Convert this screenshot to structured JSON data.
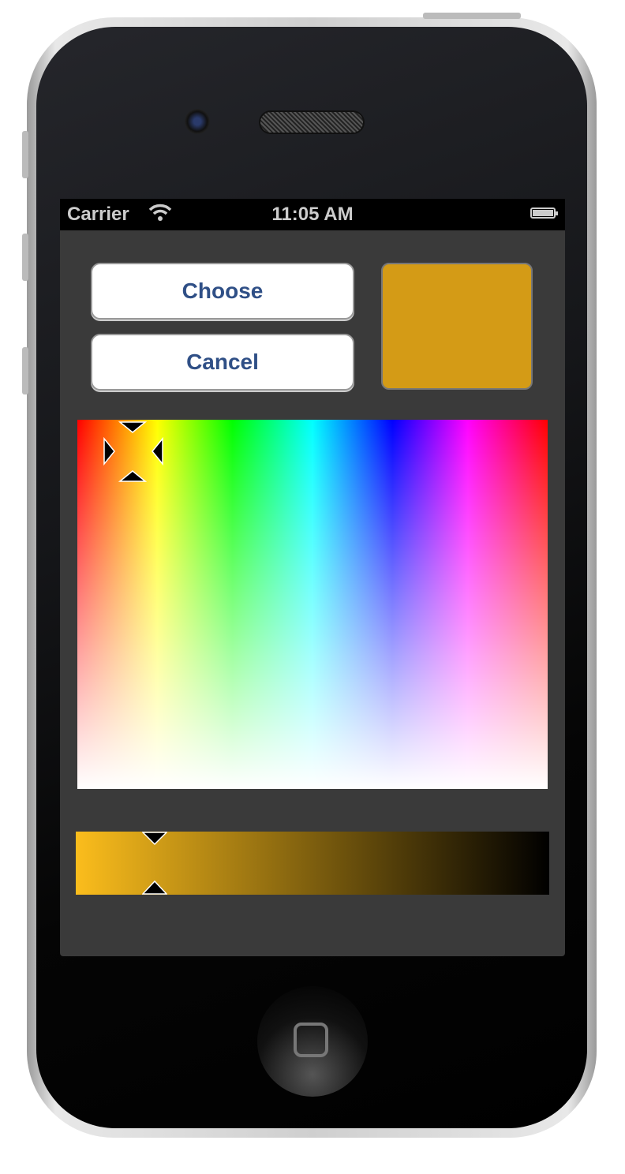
{
  "status_bar": {
    "carrier": "Carrier",
    "time": "11:05 AM",
    "wifi_icon": "wifi-icon",
    "battery_icon": "battery-icon"
  },
  "buttons": {
    "choose": "Choose",
    "cancel": "Cancel"
  },
  "selected_color": "#d49b16",
  "brightness_gradient": {
    "start": "#fbbd1c",
    "end": "#000000"
  },
  "picker": {
    "hue_saturation_crosshair_icon": "crosshair-icon",
    "brightness_marker_icon": "triangle-marker-icon"
  }
}
